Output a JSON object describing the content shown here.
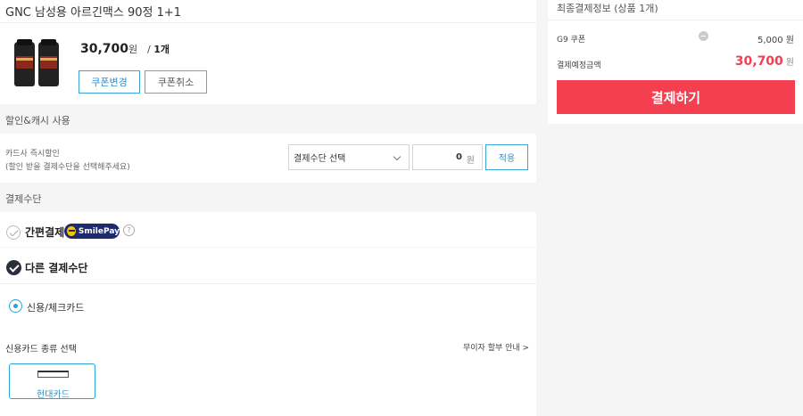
{
  "product": {
    "title": "GNC 남성용 아르긴맥스 90정 1+1",
    "price": "30,700",
    "price_unit": "원",
    "qty_sep": "/",
    "qty": "1개",
    "coupon_change": "쿠폰변경",
    "coupon_cancel": "쿠폰취소"
  },
  "discount": {
    "section_title": "할인&캐시 사용",
    "card_label": "카드사 즉시할인",
    "card_hint": "(할인 받을 결제수단을 선택해주세요)",
    "select_value": "결제수단 선택",
    "amount": "0",
    "amount_unit": "원",
    "apply": "적용"
  },
  "payment": {
    "section_title": "결제수단",
    "easy_pay": "간편결제",
    "smilepay": "SmilePay",
    "help": "?",
    "other_pay": "다른 결제수단",
    "credit_check": "신용/체크카드",
    "card_type_title": "신용카드 종류 선택",
    "interest_free": "무이자 할부 안내 >",
    "card_tile": "현대카드",
    "card_logo_text": "Hyundai Card"
  },
  "summary": {
    "title": "최종결제정보 (상품 1개)",
    "coupon_label": "G9 쿠폰",
    "coupon_value": "5,000 원",
    "total_label": "결제예정금액",
    "total_value": "30,700",
    "total_unit": "원",
    "pay_button": "결제하기"
  },
  "colors": {
    "accent_blue": "#29a3d6",
    "pay_red": "#f43f51",
    "smilepay_navy": "#1d2a6b"
  }
}
